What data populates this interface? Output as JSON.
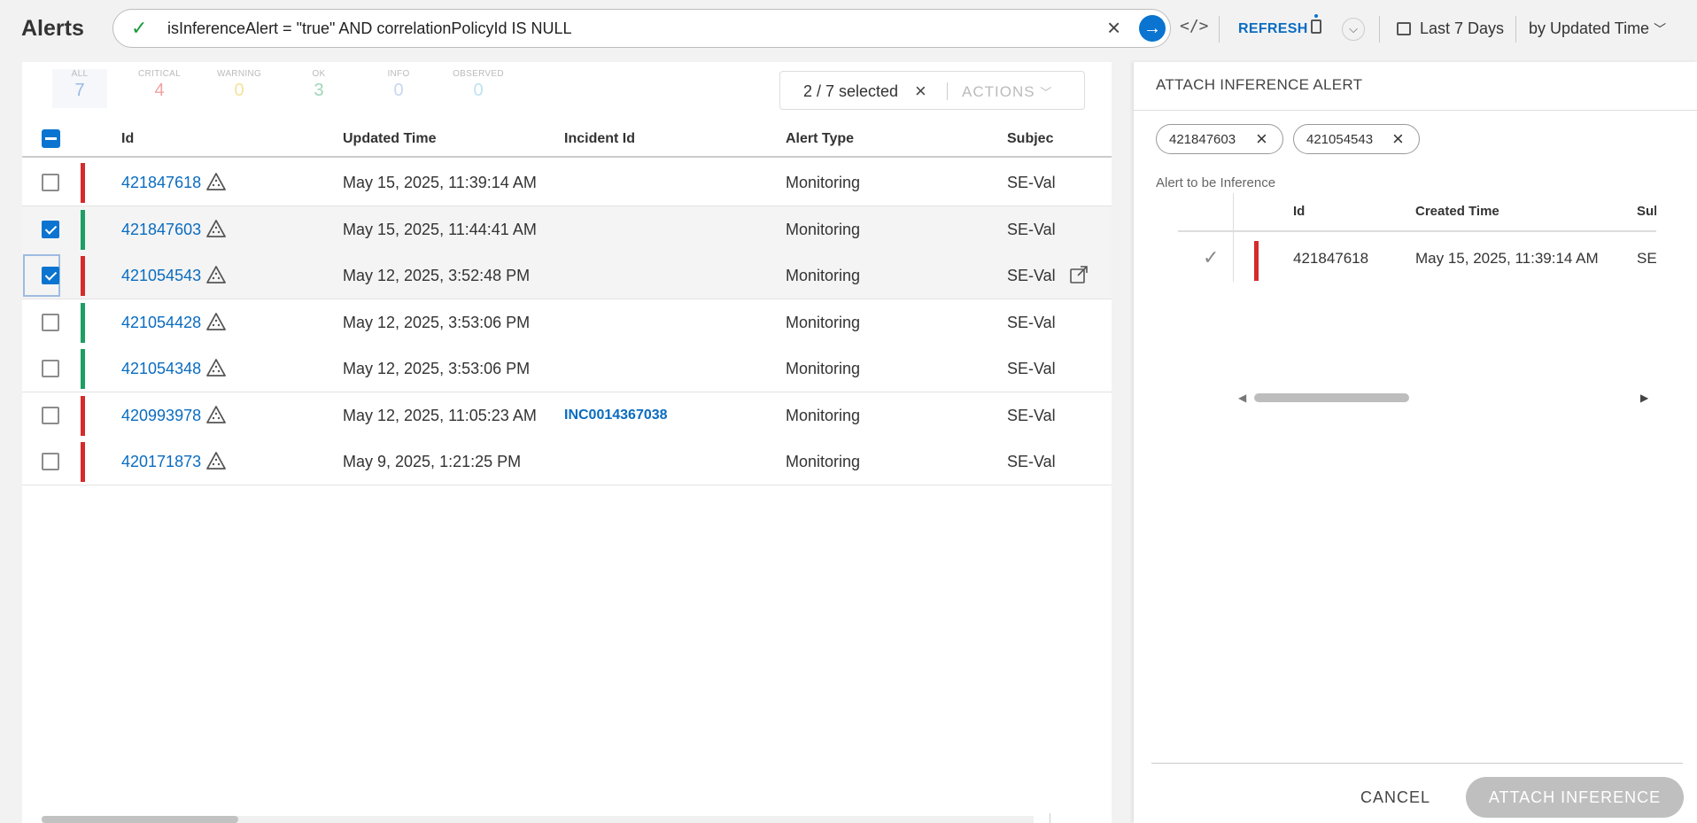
{
  "header": {
    "title": "Alerts",
    "query": "isInferenceAlert = \"true\" AND correlationPolicyId IS NULL",
    "refresh_label": "REFRESH",
    "date_range": "Last 7 Days",
    "sort_by": "by Updated Time"
  },
  "stats": [
    {
      "label": "ALL",
      "value": "7",
      "color": "#9cb8e6"
    },
    {
      "label": "CRITICAL",
      "value": "4",
      "color": "#f0a3a3"
    },
    {
      "label": "WARNING",
      "value": "0",
      "color": "#f4e39b"
    },
    {
      "label": "OK",
      "value": "3",
      "color": "#9fd6b8"
    },
    {
      "label": "INFO",
      "value": "0",
      "color": "#c9d6ef"
    },
    {
      "label": "OBSERVED",
      "value": "0",
      "color": "#bfe3ef"
    }
  ],
  "selection": {
    "text": "2 / 7 selected",
    "actions_label": "ACTIONS"
  },
  "table": {
    "columns": [
      "Id",
      "Updated Time",
      "Incident Id",
      "Alert Type",
      "Subjec"
    ],
    "rows": [
      {
        "id": "421847618",
        "updated": "May 15, 2025, 11:39:14 AM",
        "incident": "",
        "type": "Monitoring",
        "subject": "SE-Val",
        "severity": "critical",
        "checked": false
      },
      {
        "id": "421847603",
        "updated": "May 15, 2025, 11:44:41 AM",
        "incident": "",
        "type": "Monitoring",
        "subject": "SE-Val",
        "severity": "ok",
        "checked": true
      },
      {
        "id": "421054543",
        "updated": "May 12, 2025, 3:52:48 PM",
        "incident": "",
        "type": "Monitoring",
        "subject": "SE-Val",
        "severity": "critical",
        "checked": true
      },
      {
        "id": "421054428",
        "updated": "May 12, 2025, 3:53:06 PM",
        "incident": "",
        "type": "Monitoring",
        "subject": "SE-Val",
        "severity": "ok",
        "checked": false
      },
      {
        "id": "421054348",
        "updated": "May 12, 2025, 3:53:06 PM",
        "incident": "",
        "type": "Monitoring",
        "subject": "SE-Val",
        "severity": "ok",
        "checked": false
      },
      {
        "id": "420993978",
        "updated": "May 12, 2025, 11:05:23 AM",
        "incident": "INC0014367038",
        "type": "Monitoring",
        "subject": "SE-Val",
        "severity": "critical",
        "checked": false
      },
      {
        "id": "420171873",
        "updated": "May 9, 2025, 1:21:25 PM",
        "incident": "",
        "type": "Monitoring",
        "subject": "SE-Val",
        "severity": "critical",
        "checked": false
      }
    ]
  },
  "colors": {
    "critical": "#d52b2b",
    "ok": "#1e9e62",
    "accent": "#0a74d0"
  },
  "panel": {
    "title": "ATTACH INFERENCE ALERT",
    "chips": [
      "421847603",
      "421054543"
    ],
    "subtitle": "Alert to be Inference",
    "columns": [
      "Id",
      "Created Time",
      "Sul"
    ],
    "row": {
      "id": "421847618",
      "created": "May 15, 2025, 11:39:14 AM",
      "subject": "SE-"
    },
    "cancel_label": "CANCEL",
    "attach_label": "ATTACH INFERENCE"
  }
}
